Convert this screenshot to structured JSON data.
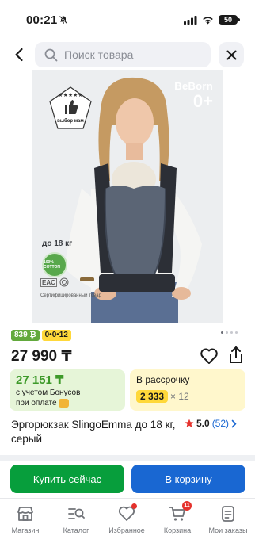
{
  "status_bar": {
    "time": "00:21",
    "battery": "50",
    "icons": [
      "bell-muted-icon",
      "signal-icon",
      "wifi-icon",
      "battery-icon"
    ]
  },
  "search": {
    "placeholder": "Поиск товара",
    "back_icon": "chevron-left-icon",
    "search_icon": "search-icon",
    "close_icon": "close-icon"
  },
  "gallery": {
    "brand": "BeBorn",
    "age": "0+",
    "award_label": "выбор мам",
    "weight_label": "до 18 кг",
    "cert_text": "Сертифицированный товар",
    "cert_mark": "EAC",
    "cotton_badge": "100% COTTON",
    "page_count": 4,
    "active_page": 1
  },
  "badges": {
    "cash": "839 ₿",
    "installment": "0•0•12"
  },
  "price": "27 990 ₸",
  "offers": {
    "bonus_amount": "27 151 ₸",
    "bonus_note_1": "с учетом Бонусов",
    "bonus_note_2": "при оплате",
    "installment_title": "В рассрочку",
    "installment_amount": "2 333",
    "installment_months": "× 12"
  },
  "product": {
    "title": "Эргорюкзак SlingoEmma до 18 кг, серый",
    "rating": "5.0",
    "reviews": "(52)"
  },
  "actions": {
    "buy_now": "Купить сейчас",
    "add_to_cart": "В корзину"
  },
  "colors": {
    "buy": "#079e3c",
    "cart": "#1967d2",
    "bonus_bg": "#e6f5d8",
    "installment_bg": "#fff7cc",
    "badge_cash": "#62a93c",
    "badge_plan": "#ffd83a",
    "star": "#e5322d"
  },
  "nav": {
    "items": [
      {
        "label": "Магазин",
        "icon": "store-icon"
      },
      {
        "label": "Каталог",
        "icon": "catalog-search-icon"
      },
      {
        "label": "Избранное",
        "icon": "heart-icon"
      },
      {
        "label": "Корзина",
        "icon": "cart-icon",
        "badge": "11"
      },
      {
        "label": "Мои заказы",
        "icon": "orders-icon"
      }
    ]
  }
}
